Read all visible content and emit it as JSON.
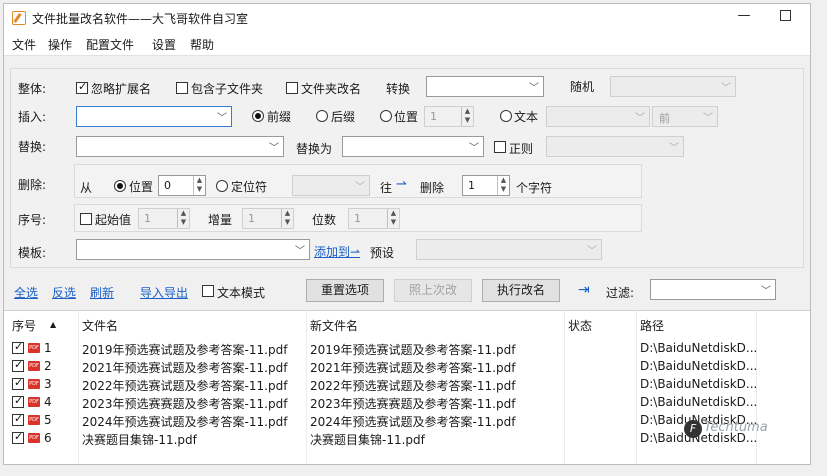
{
  "titlebar": {
    "title": "文件批量改名软件——大飞哥软件自习室",
    "min": "—"
  },
  "menu": [
    "文件",
    "操作",
    "配置文件",
    "设置",
    "帮助"
  ],
  "whole": {
    "label": "整体:",
    "ignore_ext": "忽略扩展名",
    "include_sub": "包含子文件夹",
    "folder_rename": "文件夹改名",
    "convert": "转换",
    "random": "随机"
  },
  "insert": {
    "label": "插入:",
    "prefix": "前缀",
    "suffix": "后缀",
    "position": "位置",
    "pos_value": "1",
    "text": "文本",
    "dir_value": "前"
  },
  "replace": {
    "label": "替换:",
    "replace_with": "替换为",
    "regex": "正则"
  },
  "delete": {
    "label": "删除:",
    "from": "从",
    "position": "位置",
    "pos_value": "0",
    "locator": "定位符",
    "to": "往",
    "arrow": "⇀",
    "delete_word": "删除",
    "count": "1",
    "unit": "个字符"
  },
  "serial": {
    "label": "序号:",
    "start": "起始值",
    "start_value": "1",
    "step": "增量",
    "step_value": "1",
    "digits": "位数",
    "digits_value": "1"
  },
  "template": {
    "label": "模板:",
    "add_to": "添加到⇀",
    "preset": "预设"
  },
  "toolbar": {
    "select_all": "全选",
    "invert": "反选",
    "refresh": "刷新",
    "import_export": "导入导出",
    "text_mode": "文本模式",
    "reset": "重置选项",
    "undo": "照上次改",
    "execute": "执行改名",
    "filter": "过滤:"
  },
  "table": {
    "headers": {
      "seq": "序号",
      "sort": "▲",
      "file": "文件名",
      "new_file": "新文件名",
      "status": "状态",
      "path": "路径"
    },
    "rows": [
      {
        "seq": "1",
        "file": "2019年预选赛试题及参考答案-11.pdf",
        "new_file": "2019年预选赛试题及参考答案-11.pdf",
        "path": "D:\\BaiduNetdiskD..."
      },
      {
        "seq": "2",
        "file": "2021年预选赛试题及参考答案-11.pdf",
        "new_file": "2021年预选赛试题及参考答案-11.pdf",
        "path": "D:\\BaiduNetdiskD..."
      },
      {
        "seq": "3",
        "file": "2022年预选赛试题及参考答案-11.pdf",
        "new_file": "2022年预选赛试题及参考答案-11.pdf",
        "path": "D:\\BaiduNetdiskD..."
      },
      {
        "seq": "4",
        "file": "2023年预选赛赛题及参考答案-11.pdf",
        "new_file": "2023年预选赛赛题及参考答案-11.pdf",
        "path": "D:\\BaiduNetdiskD..."
      },
      {
        "seq": "5",
        "file": "2024年预选赛试题及参考答案-11.pdf",
        "new_file": "2024年预选赛试题及参考答案-11.pdf",
        "path": "D:\\BaiduNetdiskD..."
      },
      {
        "seq": "6",
        "file": "决赛题目集锦-11.pdf",
        "new_file": "决赛题目集锦-11.pdf",
        "path": "D:\\BaiduNetdiskD..."
      }
    ]
  },
  "watermark": {
    "text": "Techtuma"
  }
}
